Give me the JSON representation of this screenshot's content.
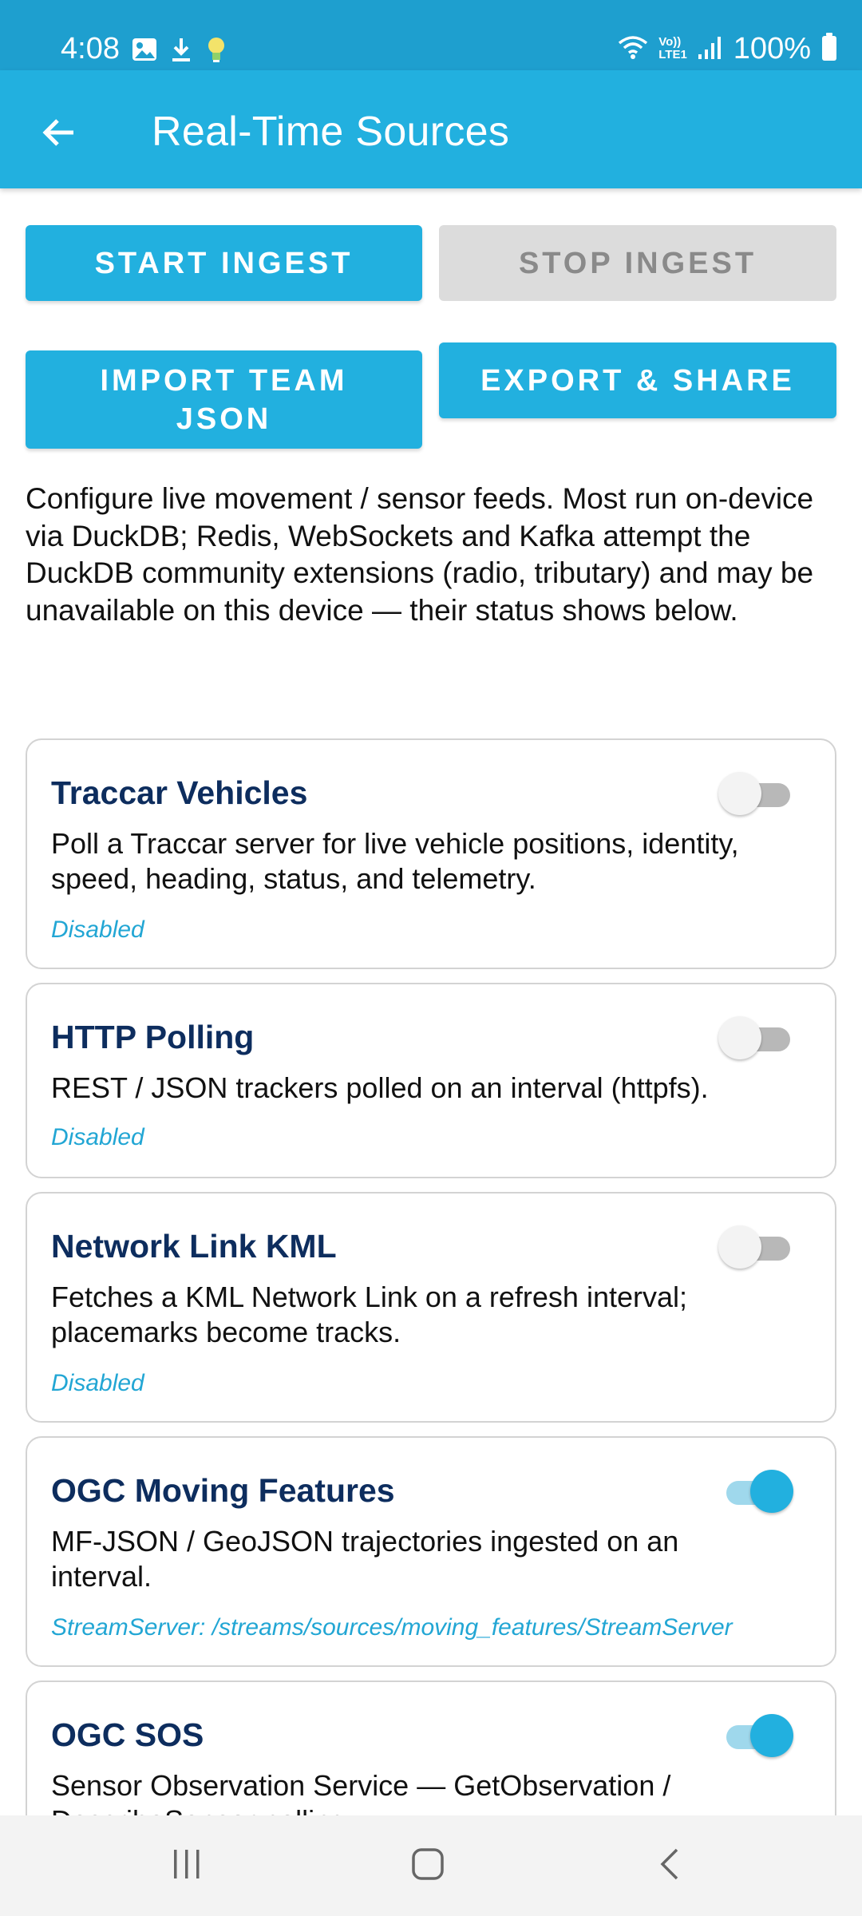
{
  "status_bar": {
    "time": "4:08",
    "battery": "100%",
    "left_icons": [
      "image-icon",
      "download-icon",
      "lightbulb-icon"
    ],
    "right_icons": [
      "wifi-icon",
      "volte-icon",
      "signal-icon",
      "battery-icon"
    ],
    "volte_text": [
      "Vo))",
      "LTE1"
    ]
  },
  "app_bar": {
    "title": "Real-Time Sources",
    "back_icon": "arrow-left-icon"
  },
  "actions": {
    "start_label": "START INGEST",
    "stop_label": "STOP INGEST",
    "import_label": "IMPORT TEAM JSON",
    "export_label": "EXPORT & SHARE"
  },
  "intro": "Configure live movement / sensor feeds. Most run on-device via DuckDB; Redis, WebSockets and Kafka attempt the DuckDB community extensions (radio, tributary) and may be unavailable on this device — their status shows below.",
  "sources": [
    {
      "title": "Traccar Vehicles",
      "description": "Poll a Traccar server for live vehicle positions, identity, speed, heading, status, and telemetry.",
      "status": "Disabled",
      "enabled": false
    },
    {
      "title": "HTTP Polling",
      "description": "REST / JSON trackers polled on an interval (httpfs).",
      "status": "Disabled",
      "enabled": false
    },
    {
      "title": "Network Link KML",
      "description": "Fetches a KML Network Link on a refresh interval; placemarks become tracks.",
      "status": "Disabled",
      "enabled": false
    },
    {
      "title": "OGC Moving Features",
      "description": "MF-JSON / GeoJSON trajectories ingested on an interval.",
      "status": "StreamServer: /streams/sources/moving_features/StreamServer",
      "enabled": true
    },
    {
      "title": "OGC SOS",
      "description": "Sensor Observation Service — GetObservation / DescribeSensor polling.",
      "status": "",
      "enabled": true
    }
  ],
  "nav_bar": {
    "icons": [
      "recents-icon",
      "home-icon",
      "back-icon"
    ]
  },
  "colors": {
    "accent": "#22b0df",
    "status_bar": "#1e9fcf",
    "title_text": "#0d2d5e",
    "status_text": "#22a6d4",
    "disabled_button": "#dcdcdc"
  }
}
